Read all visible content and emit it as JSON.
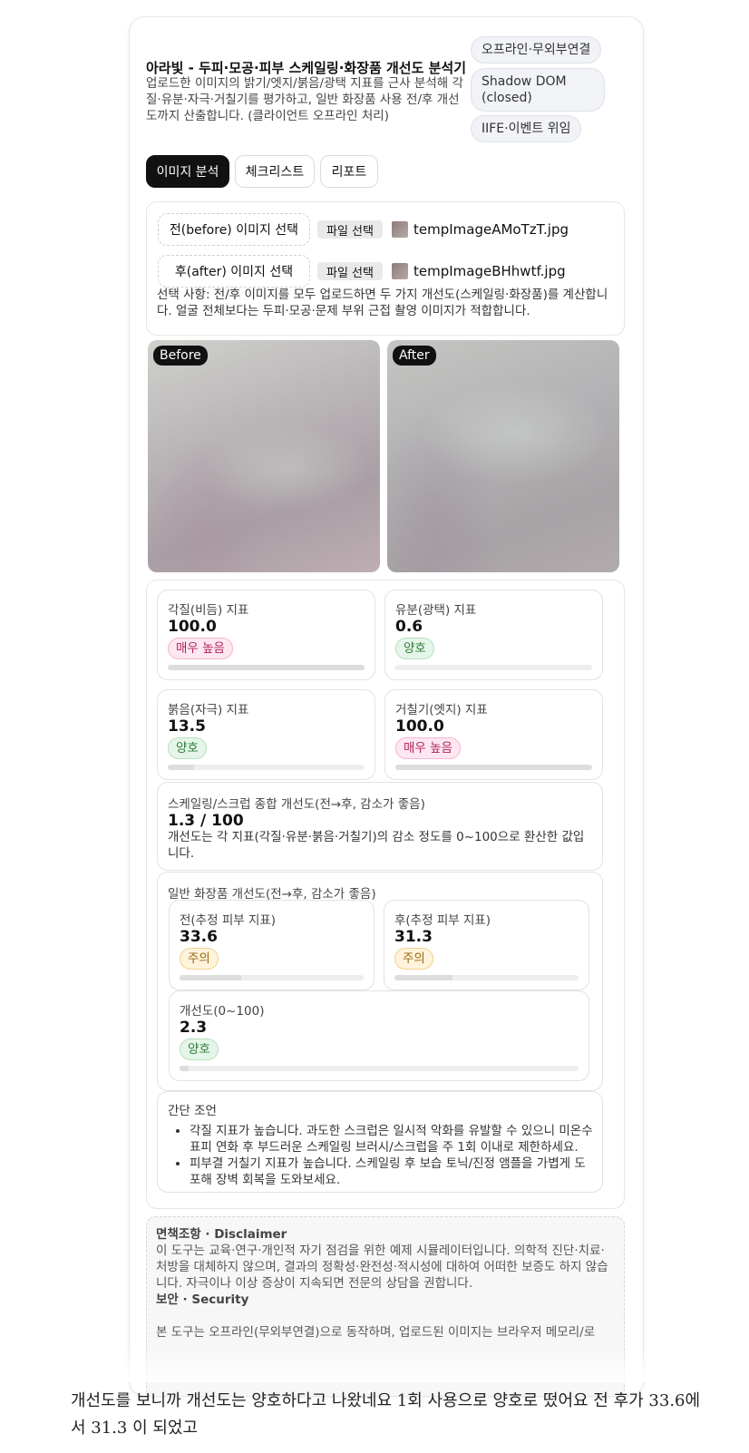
{
  "header": {
    "title": "아라빛 - 두피·모공·피부 스케일링·화장품 개선도 분석기",
    "description": "업로드한 이미지의 밝기/엣지/붉음/광택 지표를 근사 분석해 각질·유분·자극·거칠기를 평가하고, 일반 화장품 사용 전/후 개선도까지 산출합니다. (클라이언트 오프라인 처리)",
    "badges": [
      "오프라인·무외부연결",
      "Shadow DOM (closed)",
      "IIFE·이벤트 위임"
    ]
  },
  "tabs": [
    {
      "label": "이미지 분석",
      "active": true
    },
    {
      "label": "체크리스트",
      "active": false
    },
    {
      "label": "리포트",
      "active": false
    }
  ],
  "upload": {
    "before_label": "전(before) 이미지 선택",
    "after_label": "후(after) 이미지 선택",
    "file_button": "파일 선택",
    "before_file": "tempImageAMoTzT.jpg",
    "after_file": "tempImageBHhwtf.jpg",
    "note": "선택 사항: 전/후 이미지를 모두 업로드하면 두 가지 개선도(스케일링·화장품)를 계산합니다. 얼굴 전체보다는 두피·모공·문제 부위 근접 촬영 이미지가 적합합니다."
  },
  "preview": {
    "before_tag": "Before",
    "after_tag": "After"
  },
  "metrics": [
    {
      "label": "각질(비듬) 지표",
      "value": "100.0",
      "status": "매우 높음",
      "level": "high",
      "fill": 1.0
    },
    {
      "label": "유분(광택) 지표",
      "value": "0.6",
      "status": "양호",
      "level": "good",
      "fill": 0.006
    },
    {
      "label": "붉음(자극) 지표",
      "value": "13.5",
      "status": "양호",
      "level": "good",
      "fill": 0.135
    },
    {
      "label": "거칠기(엣지) 지표",
      "value": "100.0",
      "status": "매우 높음",
      "level": "high",
      "fill": 1.0
    }
  ],
  "scaling": {
    "label": "스케일링/스크럽 종합 개선도(전→후, 감소가 좋음)",
    "value": "1.3 / 100",
    "note": "개선도는 각 지표(각질·유분·붉음·거칠기)의 감소 정도를 0~100으로 환산한 값입니다."
  },
  "cosmetic": {
    "label": "일반 화장품 개선도(전→후, 감소가 좋음)",
    "before": {
      "label": "전(추정 피부 지표)",
      "value": "33.6",
      "status": "주의",
      "fill": 0.336
    },
    "after": {
      "label": "후(추정 피부 지표)",
      "value": "31.3",
      "status": "주의",
      "fill": 0.313
    },
    "improvement": {
      "label": "개선도(0~100)",
      "value": "2.3",
      "status": "양호",
      "fill": 0.023
    }
  },
  "advice": {
    "title": "간단 조언",
    "items": [
      "각질 지표가 높습니다. 과도한 스크럽은 일시적 악화를 유발할 수 있으니 미온수 표피 연화 후 부드러운 스케일링 브러시/스크럽을 주 1회 이내로 제한하세요.",
      "피부결 거칠기 지표가 높습니다. 스케일링 후 보습 토닉/진정 앰플을 가볍게 도포해 장벽 회복을 도와보세요."
    ]
  },
  "disclaimer": {
    "title": "면책조항 · Disclaimer",
    "body": "이 도구는 교육·연구·개인적 자기 점검을 위한 예제 시뮬레이터입니다. 의학적 진단·치료·처방을 대체하지 않으며, 결과의 정확성·완전성·적시성에 대하여 어떠한 보증도 하지 않습니다. 자극이나 이상 증상이 지속되면 전문의 상담을 권합니다.",
    "security_title": "보안 · Security",
    "security_body": "본 도구는 오프라인(무외부연결)으로 동작하며, 업로드된 이미지는 브라우저 메모리/로"
  },
  "caption": "개선도를 보니까 개선도는 양호하다고 나왔네요 1회 사용으로 양호로 떴어요 전 후가 33.6에서 31.3 이 되었고"
}
